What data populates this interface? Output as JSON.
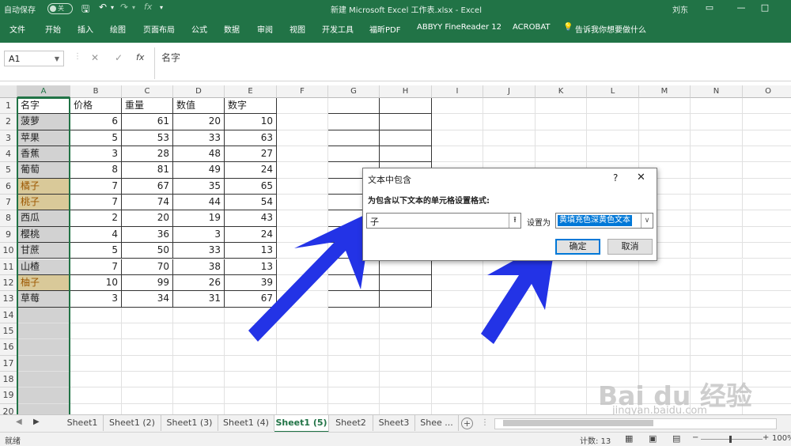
{
  "window": {
    "autosave_label": "自动保存",
    "autosave_state": "关",
    "title": "新建 Microsoft Excel 工作表.xlsx  -  Excel",
    "user": "刘东"
  },
  "ribbon_tabs": [
    "文件",
    "开始",
    "插入",
    "绘图",
    "页面布局",
    "公式",
    "数据",
    "审阅",
    "视图",
    "开发工具",
    "福昕PDF",
    "ABBYY FineReader 12",
    "ACROBAT"
  ],
  "tell_me": "告诉我你想要做什么",
  "formula_bar": {
    "name_box": "A1",
    "fx_label": "fx",
    "content": "名字"
  },
  "columns": [
    "A",
    "B",
    "C",
    "D",
    "E",
    "F",
    "G",
    "H",
    "I",
    "J",
    "K",
    "L",
    "M",
    "N",
    "O"
  ],
  "rows": [
    "1",
    "2",
    "3",
    "4",
    "5",
    "6",
    "7",
    "8",
    "9",
    "10",
    "11",
    "12",
    "13",
    "14",
    "15",
    "16",
    "17",
    "18",
    "19",
    "20"
  ],
  "table": {
    "headers": [
      "名字",
      "价格",
      "重量",
      "数值",
      "数字"
    ],
    "rows": [
      [
        "菠萝",
        "6",
        "61",
        "20",
        "10"
      ],
      [
        "苹果",
        "5",
        "53",
        "33",
        "63"
      ],
      [
        "香蕉",
        "3",
        "28",
        "48",
        "27"
      ],
      [
        "葡萄",
        "8",
        "81",
        "49",
        "24"
      ],
      [
        "橘子",
        "7",
        "67",
        "35",
        "65"
      ],
      [
        "桃子",
        "7",
        "74",
        "44",
        "54"
      ],
      [
        "西瓜",
        "2",
        "20",
        "19",
        "43"
      ],
      [
        "樱桃",
        "4",
        "36",
        "3",
        "24"
      ],
      [
        "甘蔗",
        "5",
        "50",
        "33",
        "13"
      ],
      [
        "山楂",
        "7",
        "70",
        "38",
        "13"
      ],
      [
        "柚子",
        "10",
        "99",
        "26",
        "39"
      ],
      [
        "草莓",
        "3",
        "34",
        "31",
        "67"
      ]
    ],
    "highlight_color": "#d9c999",
    "highlight_text_color": "#9c5700"
  },
  "dialog": {
    "title": "文本中包含",
    "help": "?",
    "close": "✕",
    "instruction": "为包含以下文本的单元格设置格式:",
    "text_value": "子",
    "set_as_label": "设置为",
    "format_value": "黄填充色深黄色文本",
    "ok_label": "确定",
    "cancel_label": "取消"
  },
  "sheet_tabs": [
    "Sheet1",
    "Sheet1 (2)",
    "Sheet1 (3)",
    "Sheet1 (4)",
    "Sheet1 (5)",
    "Sheet2",
    "Sheet3",
    "Shee ..."
  ],
  "active_sheet": "Sheet1 (5)",
  "status": {
    "mode": "就绪",
    "count": "计数: 13",
    "zoom": "100%"
  },
  "watermark": {
    "brand": "Bai du 经验",
    "url": "jingyan.baidu.com"
  },
  "annotation_color": "#2333e6"
}
